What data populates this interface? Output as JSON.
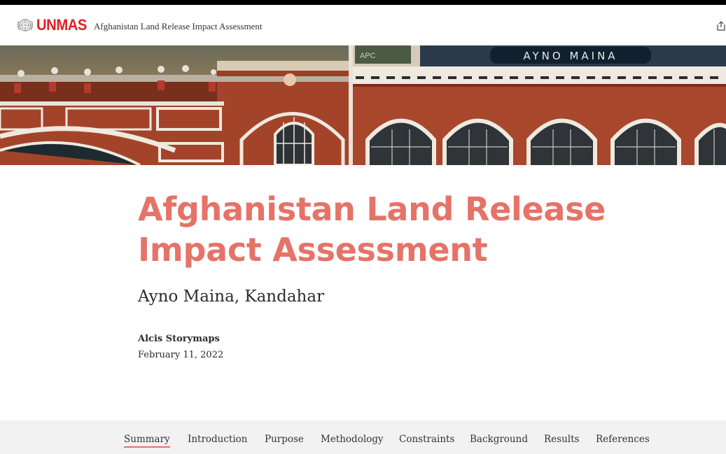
{
  "header": {
    "logo_text": "UNMAS",
    "title": "Afghanistan Land Release Impact Assessment"
  },
  "hero": {
    "sign_text": "AYNO MAINA",
    "sign_small": "APC"
  },
  "story": {
    "title": "Afghanistan Land Release Impact Assessment",
    "subtitle": "Ayno Maina, Kandahar",
    "author": "Alcis Storymaps",
    "date": "February 11, 2022"
  },
  "nav": {
    "items": [
      {
        "label": "Summary",
        "active": true
      },
      {
        "label": "Introduction"
      },
      {
        "label": "Purpose"
      },
      {
        "label": "Methodology"
      },
      {
        "label": "Constraints"
      },
      {
        "label": "Background"
      },
      {
        "label": "Results"
      },
      {
        "label": "References"
      }
    ]
  },
  "colors": {
    "accent": "#e57368",
    "brand": "#e31e24",
    "nav_bg": "#f2f2f2"
  }
}
